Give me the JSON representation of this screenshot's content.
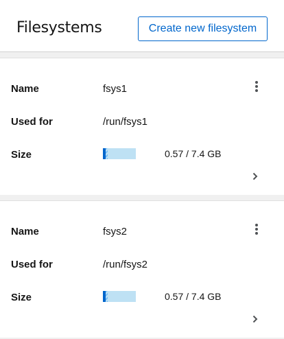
{
  "header": {
    "title": "Filesystems",
    "create_button_label": "Create new filesystem"
  },
  "labels": {
    "name": "Name",
    "used_for": "Used for",
    "size": "Size"
  },
  "filesystems": [
    {
      "name": "fsys1",
      "used_for": "/run/fsys1",
      "size_text": "0.57 / 7.4 GB",
      "usage_fraction": 0.077
    },
    {
      "name": "fsys2",
      "used_for": "/run/fsys2",
      "size_text": "0.57 / 7.4 GB",
      "usage_fraction": 0.077
    }
  ],
  "icons": {
    "menu": "kebab-icon",
    "expand": "chevron-right-icon"
  },
  "colors": {
    "accent": "#0066cc",
    "bar_background": "#bee1f4"
  }
}
